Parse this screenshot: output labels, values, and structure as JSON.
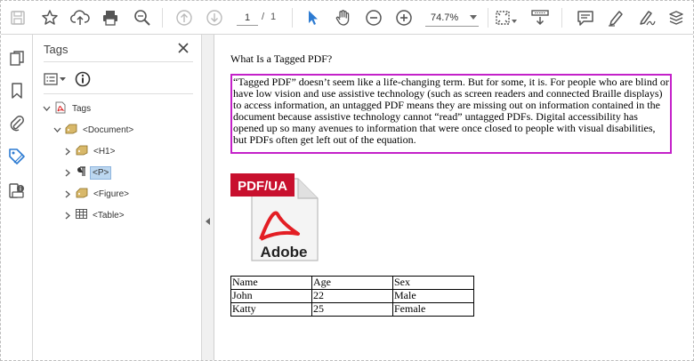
{
  "toolbar": {
    "page_current": "1",
    "page_separator": "/",
    "page_total": "1",
    "zoom": "74.7%",
    "icons": [
      "save-icon",
      "bookmark-star-icon",
      "upload-icon",
      "print-icon",
      "search-zoom-icon",
      "page-up-icon",
      "page-down-icon",
      "select-cursor-icon",
      "hand-tool-icon",
      "zoom-out-icon",
      "zoom-in-icon",
      "fit-page-icon",
      "scroll-mode-icon",
      "comment-icon",
      "highlight-icon",
      "sign-icon",
      "more-icon"
    ],
    "accent": "#2d7bd2"
  },
  "rail": {
    "icons": [
      "pages-icon",
      "bookmarks-icon",
      "attachments-icon",
      "tags-icon",
      "accessibility-icon"
    ]
  },
  "panel": {
    "title": "Tags",
    "tree": [
      {
        "label": "Tags",
        "level": 0,
        "expanded": true,
        "icon": "pdf-tags-icon"
      },
      {
        "label": "<Document>",
        "level": 1,
        "expanded": true,
        "icon": "tag-icon"
      },
      {
        "label": "<H1>",
        "level": 2,
        "expanded": false,
        "icon": "tag-icon"
      },
      {
        "label": "<P>",
        "level": 2,
        "expanded": false,
        "icon": "paragraph-icon",
        "selected": true
      },
      {
        "label": "<Figure>",
        "level": 2,
        "expanded": false,
        "icon": "tag-icon"
      },
      {
        "label": "<Table>",
        "level": 2,
        "expanded": false,
        "icon": "table-icon"
      }
    ]
  },
  "document": {
    "title": "What Is a Tagged PDF?",
    "paragraph": "“Tagged PDF” doesn’t seem like a life-changing term. But for some, it is. For people who are blind or have low vision and use assistive technology (such as screen readers and connected Braille displays) to access information, an untagged PDF means they are missing out on information contained in the document because assistive technology cannot “read” untagged PDFs.  Digital accessibility has opened up so many avenues to information that were once closed to people with visual disabilities, but PDFs often get left out of the equation.",
    "highlight_color": "#c421c9",
    "badge": {
      "top_label": "PDF/UA",
      "bottom_label": "Adobe"
    },
    "table": {
      "rows": [
        [
          "Name",
          "Age",
          "Sex"
        ],
        [
          "John",
          "22",
          "Male"
        ],
        [
          "Katty",
          "25",
          "Female"
        ]
      ]
    }
  }
}
